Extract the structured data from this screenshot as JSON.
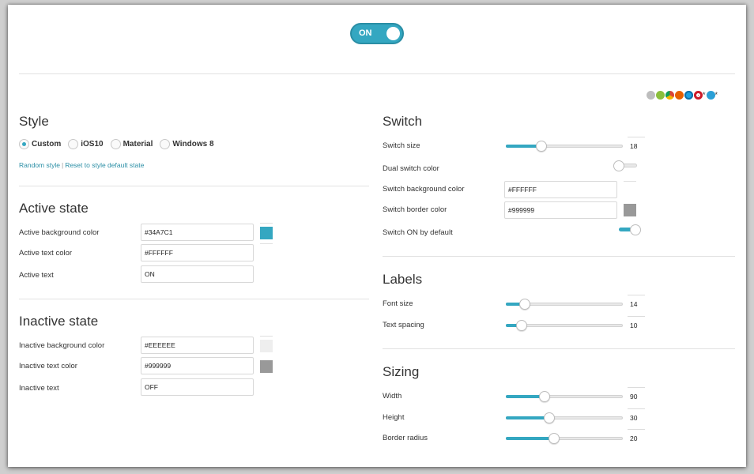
{
  "preview": {
    "text": "ON",
    "state": "on",
    "color": "#34A7C1"
  },
  "browser_icons": [
    "apple-icon",
    "android-icon",
    "chrome-icon",
    "firefox-icon",
    "ie-icon",
    "opera-icon",
    "safari-icon"
  ],
  "style": {
    "heading": "Style",
    "options": [
      "Custom",
      "iOS10",
      "Material",
      "Windows 8"
    ],
    "selected": "Custom",
    "random_link": "Random style",
    "separator": "|",
    "reset_link": "Reset to style default state"
  },
  "active": {
    "heading": "Active state",
    "bg_label": "Active background color",
    "bg_value": "#34A7C1",
    "text_color_label": "Active text color",
    "text_color_value": "#FFFFFF",
    "text_label": "Active text",
    "text_value": "ON"
  },
  "inactive": {
    "heading": "Inactive state",
    "bg_label": "Inactive background color",
    "bg_value": "#EEEEEE",
    "text_color_label": "Inactive text color",
    "text_color_value": "#999999",
    "text_label": "Inactive text",
    "text_value": "OFF"
  },
  "switch": {
    "heading": "Switch",
    "size_label": "Switch size",
    "size_value": "18",
    "size_fraction": 0.28,
    "dual_label": "Dual switch color",
    "dual_on": false,
    "bg_label": "Switch background color",
    "bg_value": "#FFFFFF",
    "border_label": "Switch border color",
    "border_value": "#999999",
    "default_label": "Switch ON by default",
    "default_on": true
  },
  "labels": {
    "heading": "Labels",
    "font_label": "Font size",
    "font_value": "14",
    "font_fraction": 0.13,
    "spacing_label": "Text spacing",
    "spacing_value": "10",
    "spacing_fraction": 0.1
  },
  "sizing": {
    "heading": "Sizing",
    "width_label": "Width",
    "width_value": "90",
    "width_fraction": 0.31,
    "height_label": "Height",
    "height_value": "30",
    "height_fraction": 0.36,
    "radius_label": "Border radius",
    "radius_value": "20",
    "radius_fraction": 0.4
  }
}
